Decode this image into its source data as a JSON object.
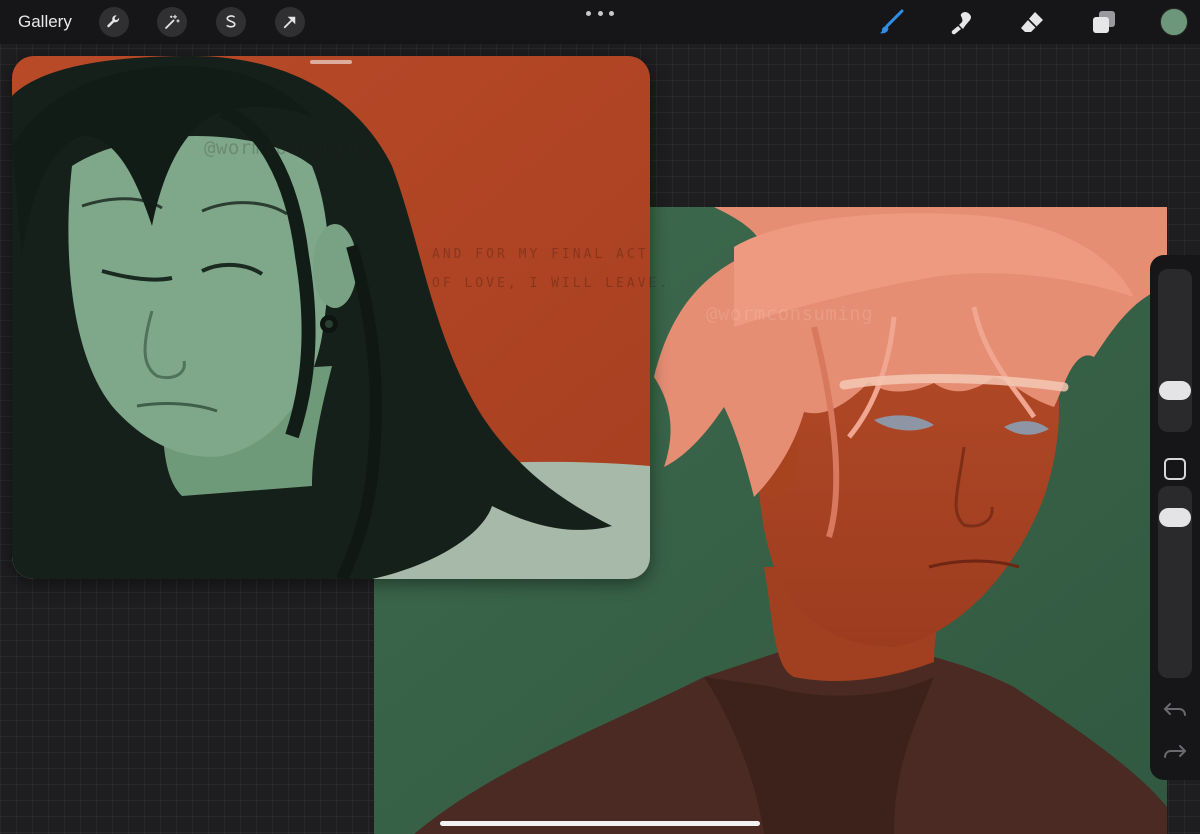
{
  "toolbar": {
    "gallery_label": "Gallery",
    "left_tools": [
      "wrench-icon",
      "magic-wand-icon",
      "selection-icon",
      "transform-arrow-icon"
    ],
    "right_tools": [
      "brush-icon",
      "smudge-icon",
      "eraser-icon",
      "layers-icon"
    ],
    "accent_color": "#2f8fe8",
    "current_color": "#6d977b"
  },
  "canvas": {
    "left_artwork": {
      "watermark": "@wormconsuming",
      "note_line_1": "AND FOR MY FINAL ACT",
      "note_line_2": "OF LOVE, I WILL LEAVE."
    },
    "right_artwork": {
      "watermark": "@wormconsuming"
    }
  },
  "sidebar": {
    "controls": [
      "brush-size-slider",
      "modify-button",
      "opacity-slider",
      "undo-icon",
      "redo-icon"
    ]
  }
}
